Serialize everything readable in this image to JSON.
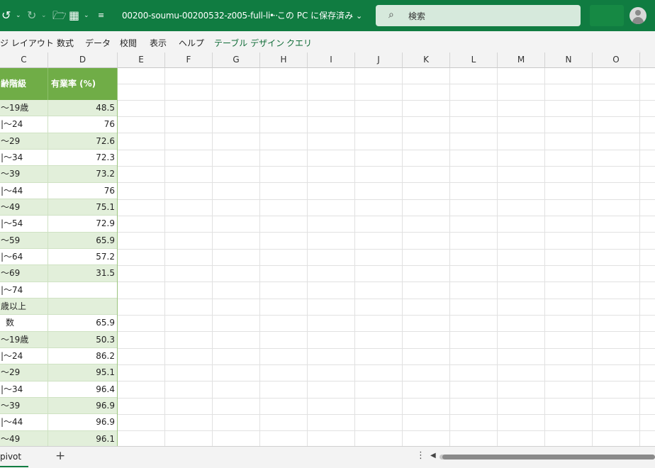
{
  "titlebar": {
    "undo_icon": "undo-icon",
    "redo_icon": "redo-icon",
    "open_icon": "folder-open-icon",
    "layout_icon": "table-layout-icon",
    "customize_icon": "customize-toolbar-icon",
    "document_title": "00200-soumu-00200532-z005-full-li···",
    "save_status": "• この PC に保存済み",
    "search_placeholder": "検索",
    "accent_color": "#107c41"
  },
  "ribbon": {
    "tabs": [
      "ジ レイアウト",
      "数式",
      "データ",
      "校閲",
      "表示",
      "ヘルプ",
      "テーブル デザイン",
      "クエリ"
    ]
  },
  "columns": [
    "C",
    "D",
    "E",
    "F",
    "G",
    "H",
    "I",
    "J",
    "K",
    "L",
    "M",
    "N",
    "O"
  ],
  "table": {
    "header": [
      "齢階級",
      "有業率 (%)"
    ],
    "rows": [
      [
        "～19歳",
        "48.5"
      ],
      [
        "|～24",
        "76"
      ],
      [
        "～29",
        "72.6"
      ],
      [
        "|～34",
        "72.3"
      ],
      [
        "～39",
        "73.2"
      ],
      [
        "|～44",
        "76"
      ],
      [
        "～49",
        "75.1"
      ],
      [
        "|～54",
        "72.9"
      ],
      [
        "～59",
        "65.9"
      ],
      [
        "|～64",
        "57.2"
      ],
      [
        "～69",
        "31.5"
      ],
      [
        "|～74",
        ""
      ],
      [
        "歳以上",
        ""
      ],
      [
        "数",
        "65.9"
      ],
      [
        "～19歳",
        "50.3"
      ],
      [
        "|～24",
        "86.2"
      ],
      [
        "～29",
        "95.1"
      ],
      [
        "|～34",
        "96.4"
      ],
      [
        "～39",
        "96.9"
      ],
      [
        "|～44",
        "96.9"
      ],
      [
        "～49",
        "96.1"
      ]
    ]
  },
  "sheetbar": {
    "active_sheet": "pivot",
    "add_label": "+",
    "more_label": "⋮"
  }
}
